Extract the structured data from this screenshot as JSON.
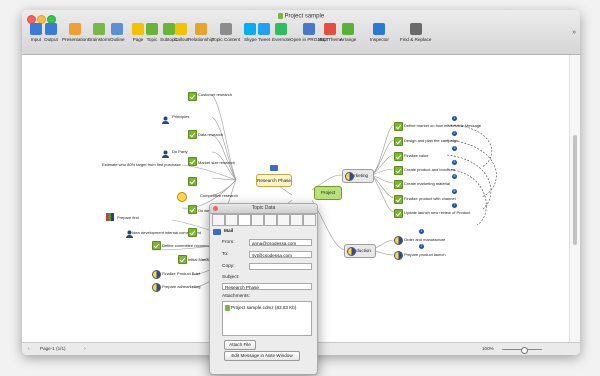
{
  "window": {
    "title": "Project sample",
    "overflow_icon": "double-chevron-right-icon"
  },
  "toolbar": {
    "items": [
      {
        "label": "Input",
        "icon": "input-icon",
        "color": "#3a7bd5"
      },
      {
        "label": "Output",
        "icon": "output-icon",
        "color": "#3a7bd5"
      },
      {
        "label": "Presentation",
        "icon": "presentation-icon",
        "color": "#f0a030"
      },
      {
        "label": "Brainstorm",
        "icon": "brainstorm-icon",
        "color": "#7ab648"
      },
      {
        "label": "Outline",
        "icon": "outline-icon",
        "color": "#5b8fd6"
      },
      {
        "label": "Page",
        "icon": "page-icon",
        "color": "#f2c200"
      },
      {
        "label": "Topic",
        "icon": "topic-icon",
        "color": "#67b537"
      },
      {
        "label": "Subtopic",
        "icon": "subtopic-icon",
        "color": "#67b537"
      },
      {
        "label": "Callout",
        "icon": "callout-icon",
        "color": "#f2c200"
      },
      {
        "label": "Relationship",
        "icon": "relationship-icon",
        "color": "#e8a32a"
      },
      {
        "label": "Topic Content",
        "icon": "topic-content-icon",
        "color": "#8c8c8c"
      },
      {
        "label": "Skype",
        "icon": "skype-icon",
        "color": "#00aff0"
      },
      {
        "label": "Tweet",
        "icon": "tweet-icon",
        "color": "#1da1f2"
      },
      {
        "label": "Evernote",
        "icon": "evernote-icon",
        "color": "#2dbe60"
      },
      {
        "label": "Open in PROJECT",
        "icon": "project-icon",
        "color": "#4a78c8"
      },
      {
        "label": "Map Theme",
        "icon": "map-theme-icon",
        "color": "#e64d3d"
      },
      {
        "label": "Arrange",
        "icon": "arrange-icon",
        "color": "#59b237"
      },
      {
        "label": "Inspector",
        "icon": "inspector-icon",
        "color": "#2a7ad5"
      },
      {
        "label": "Find & Replace",
        "icon": "find-replace-icon",
        "color": "#6a6a6a"
      }
    ]
  },
  "map": {
    "central": "Project",
    "main_topics": {
      "research": "Research Phase",
      "marketing": "Marketing",
      "production": "Production"
    },
    "research_subtopics": [
      "Customer research",
      "Principles",
      "Data research",
      "Do Party",
      "Market size research",
      "Estimate who 80% target from first purchase",
      "Competitive research",
      "Do we selling products",
      "Idea development internal commitment"
    ],
    "left_lower": [
      "Prepare first",
      "Define committee recommendations and sign off",
      "Initial Management Approval",
      "Finalize Product Brief",
      "Prepare ad/marketing",
      "Product technical specs"
    ],
    "marketing_subtopics": [
      "Define market on how marketable Message",
      "Design and plan the campaign",
      "Finalize value",
      "Create product and brochure",
      "Create marketing material",
      "Finalize product with channel",
      "Update launch new review of Product"
    ],
    "production_subtopics": [
      "Order and manufacture",
      "Prepare product launch"
    ]
  },
  "status": {
    "page": "Page-1 (1/1)",
    "zoom": "100%"
  },
  "panel": {
    "title": "Topic Data",
    "section": "Mail",
    "from_label": "From:",
    "from_value": "anna@csodessa.com",
    "to_label": "To:",
    "to_value": "svt@csodessa.com",
    "copy_label": "Copy:",
    "copy_value": "",
    "subject_label": "Subject:",
    "subject_value": "Research Phase",
    "attachments_label": "Attachments:",
    "attachment": "Project sample.cdmz  (83.83 Kb)",
    "attach_button": "Attach File",
    "edit_button": "Edit Message in Note Window"
  },
  "colors": {
    "accent": "#7bb82d",
    "node_blue": "#1d4fa0",
    "central_fill": "#b8e07a"
  }
}
